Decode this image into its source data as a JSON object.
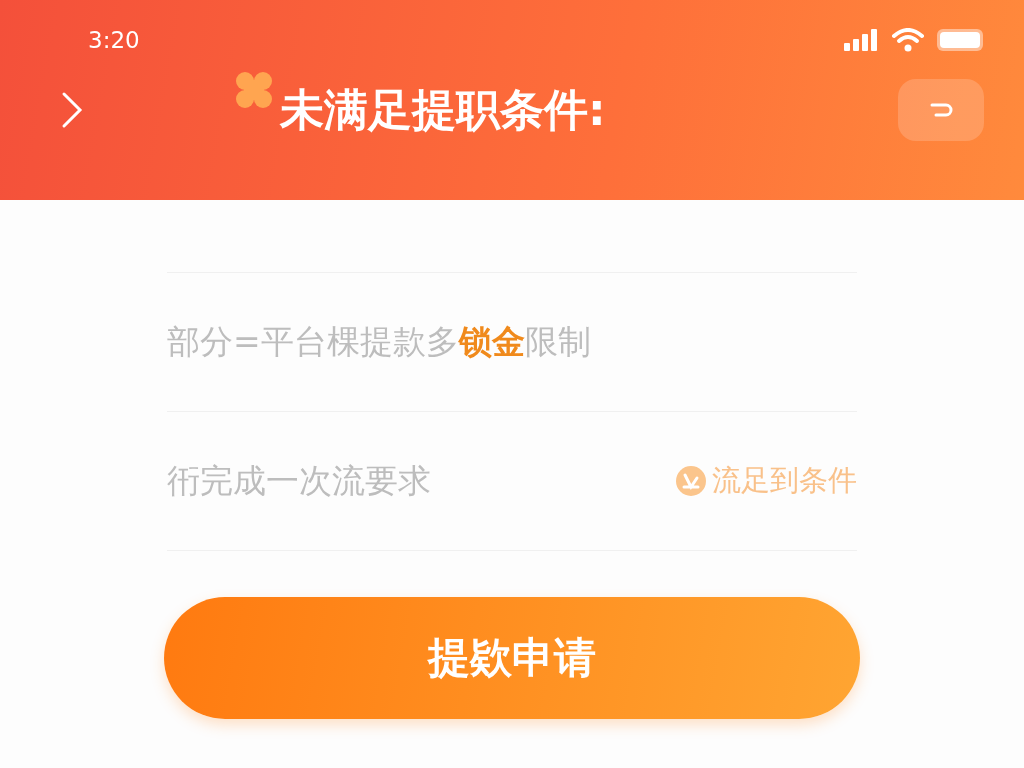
{
  "status_bar": {
    "time": "3:20"
  },
  "header": {
    "title": "未满足提职条件:"
  },
  "conditions": [
    {
      "kind": "plain",
      "text": "部分=平台棵提款多**锁金**限制"
    },
    {
      "kind": "action",
      "text": "衎完成一次流要求",
      "action": "流足到条件"
    }
  ],
  "submit_button": {
    "label": "提欵申请"
  }
}
